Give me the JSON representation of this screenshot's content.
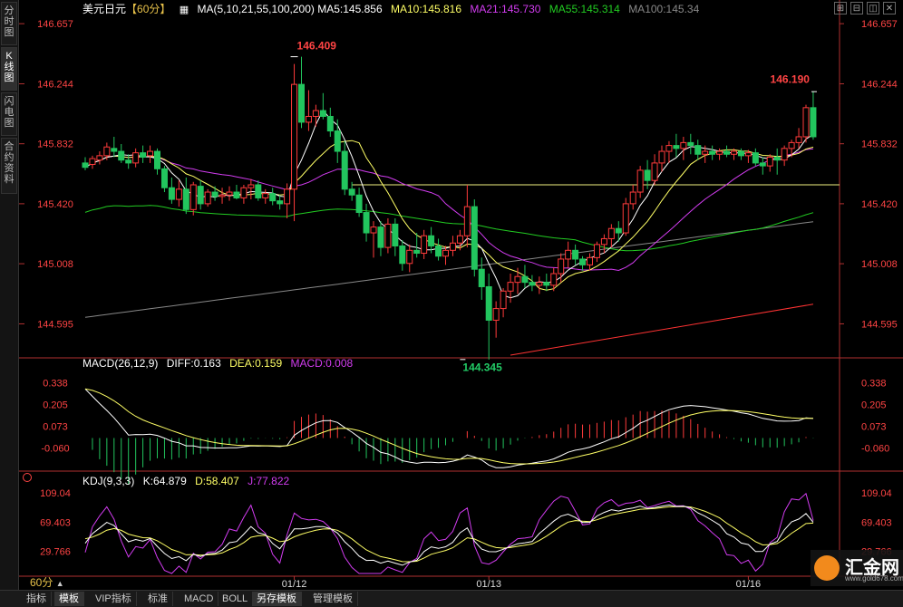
{
  "sidebar": {
    "tabs": [
      {
        "label": "分时图",
        "active": false
      },
      {
        "label": "K线图",
        "active": true
      },
      {
        "label": "闪电图",
        "active": false
      },
      {
        "label": "合约资料",
        "active": false
      }
    ]
  },
  "header": {
    "symbol": "美元日元",
    "period_tag": "【60分】",
    "ma_params": "MA(5,10,21,55,100,200)",
    "ma5": "MA5:145.856",
    "ma10": "MA10:145.816",
    "ma21": "MA21:145.730",
    "ma55": "MA55:145.314",
    "ma100": "MA100:145.34"
  },
  "macd_legend": {
    "params": "MACD(26,12,9)",
    "diff": "DIFF:0.163",
    "dea": "DEA:0.159",
    "macd": "MACD:0.008"
  },
  "kdj_legend": {
    "params": "KDJ(9,3,3)",
    "k": "K:64.879",
    "d": "D:58.407",
    "j": "J:77.822"
  },
  "bottom_bar": {
    "period": "60分",
    "items": [
      {
        "label": "指标",
        "active": false
      },
      {
        "label": "模板",
        "active": true
      },
      {
        "label": "VIP指标",
        "active": false
      },
      {
        "label": "标准",
        "active": false
      },
      {
        "label": "MACD",
        "active": false
      },
      {
        "label": "BOLL",
        "active": false
      },
      {
        "label": "另存模板",
        "active": true
      },
      {
        "label": "管理模板",
        "active": false
      }
    ]
  },
  "logo": {
    "name": "汇金网",
    "url": "www.gold678.com"
  },
  "colors": {
    "up": "#ff3b3b",
    "down": "#22c55e",
    "ma5": "#ffffff",
    "ma10": "#ffff66",
    "ma21": "#d23cf0",
    "ma55": "#22cc22",
    "ma100": "#888888",
    "ma200": "#ff3333",
    "hline": "#f0f080",
    "price_label": "#ff4444",
    "low_label": "#22cc66",
    "axis": "#ff4444"
  },
  "chart_data": {
    "type": "candlestick",
    "price_axis_ticks": [
      146.657,
      146.244,
      145.832,
      145.42,
      145.008,
      144.595
    ],
    "price_ylim": [
      144.38,
      146.72
    ],
    "x_labels": [
      {
        "index": 29,
        "label": "01/12"
      },
      {
        "index": 56,
        "label": "01/13"
      },
      {
        "index": 92,
        "label": "01/16"
      }
    ],
    "annotations": {
      "high": "146.409",
      "high_index": 29,
      "low": "144.345",
      "low_index": 52,
      "last_high": "146.190",
      "last_index": 101
    },
    "horizontal_line": 145.55,
    "candles": [
      [
        145.7,
        145.74,
        145.65,
        145.67
      ],
      [
        145.69,
        145.75,
        145.66,
        145.73
      ],
      [
        145.72,
        145.78,
        145.69,
        145.75
      ],
      [
        145.75,
        145.84,
        145.72,
        145.81
      ],
      [
        145.8,
        145.88,
        145.74,
        145.78
      ],
      [
        145.78,
        145.83,
        145.7,
        145.72
      ],
      [
        145.72,
        145.76,
        145.66,
        145.7
      ],
      [
        145.7,
        145.8,
        145.67,
        145.77
      ],
      [
        145.77,
        145.82,
        145.7,
        145.74
      ],
      [
        145.75,
        145.82,
        145.7,
        145.78
      ],
      [
        145.78,
        145.8,
        145.62,
        145.66
      ],
      [
        145.66,
        145.68,
        145.5,
        145.53
      ],
      [
        145.53,
        145.6,
        145.42,
        145.45
      ],
      [
        145.45,
        145.58,
        145.4,
        145.52
      ],
      [
        145.52,
        145.6,
        145.35,
        145.38
      ],
      [
        145.38,
        145.57,
        145.34,
        145.55
      ],
      [
        145.54,
        145.58,
        145.38,
        145.42
      ],
      [
        145.42,
        145.52,
        145.4,
        145.5
      ],
      [
        145.5,
        145.54,
        145.44,
        145.47
      ],
      [
        145.47,
        145.53,
        145.42,
        145.48
      ],
      [
        145.48,
        145.54,
        145.44,
        145.5
      ],
      [
        145.5,
        145.55,
        145.45,
        145.46
      ],
      [
        145.46,
        145.55,
        145.42,
        145.53
      ],
      [
        145.53,
        145.59,
        145.45,
        145.55
      ],
      [
        145.55,
        145.58,
        145.44,
        145.46
      ],
      [
        145.46,
        145.52,
        145.42,
        145.49
      ],
      [
        145.49,
        145.53,
        145.41,
        145.44
      ],
      [
        145.44,
        145.48,
        145.38,
        145.42
      ],
      [
        145.42,
        145.56,
        145.32,
        145.52
      ],
      [
        145.52,
        146.38,
        145.3,
        146.24
      ],
      [
        146.24,
        146.43,
        145.94,
        145.98
      ],
      [
        145.98,
        146.2,
        145.92,
        146.02
      ],
      [
        146.02,
        146.1,
        145.95,
        146.06
      ],
      [
        146.06,
        146.18,
        146.0,
        146.02
      ],
      [
        146.02,
        146.08,
        145.88,
        145.92
      ],
      [
        145.92,
        146.0,
        145.7,
        145.78
      ],
      [
        145.78,
        145.85,
        145.48,
        145.52
      ],
      [
        145.52,
        145.57,
        145.44,
        145.48
      ],
      [
        145.48,
        145.53,
        145.33,
        145.36
      ],
      [
        145.36,
        145.42,
        145.16,
        145.22
      ],
      [
        145.22,
        145.3,
        145.05,
        145.26
      ],
      [
        145.26,
        145.3,
        145.06,
        145.12
      ],
      [
        145.12,
        145.32,
        145.08,
        145.28
      ],
      [
        145.28,
        145.32,
        145.06,
        145.13
      ],
      [
        145.13,
        145.17,
        144.96,
        145.01
      ],
      [
        145.01,
        145.14,
        144.95,
        145.1
      ],
      [
        145.1,
        145.22,
        145.05,
        145.08
      ],
      [
        145.08,
        145.24,
        145.04,
        145.2
      ],
      [
        145.2,
        145.26,
        145.08,
        145.13
      ],
      [
        145.13,
        145.18,
        145.03,
        145.06
      ],
      [
        145.06,
        145.13,
        145.0,
        145.1
      ],
      [
        145.1,
        145.2,
        145.06,
        145.15
      ],
      [
        145.15,
        145.24,
        145.1,
        145.2
      ],
      [
        145.2,
        145.55,
        145.12,
        145.4
      ],
      [
        145.4,
        145.45,
        144.92,
        144.97
      ],
      [
        144.97,
        145.05,
        144.76,
        144.85
      ],
      [
        144.85,
        144.94,
        144.35,
        144.62
      ],
      [
        144.62,
        144.75,
        144.5,
        144.7
      ],
      [
        144.7,
        144.84,
        144.64,
        144.82
      ],
      [
        144.82,
        144.94,
        144.74,
        144.88
      ],
      [
        144.88,
        144.98,
        144.8,
        144.92
      ],
      [
        144.92,
        145.0,
        144.84,
        144.88
      ],
      [
        144.88,
        144.93,
        144.82,
        144.86
      ],
      [
        144.86,
        144.92,
        144.8,
        144.88
      ],
      [
        144.88,
        144.94,
        144.82,
        144.86
      ],
      [
        144.86,
        144.98,
        144.82,
        144.94
      ],
      [
        144.94,
        145.08,
        144.88,
        145.04
      ],
      [
        145.04,
        145.16,
        144.98,
        145.1
      ],
      [
        145.1,
        145.14,
        145.0,
        145.04
      ],
      [
        145.04,
        145.06,
        144.96,
        145.0
      ],
      [
        145.0,
        145.08,
        144.96,
        145.05
      ],
      [
        145.05,
        145.16,
        145.02,
        145.14
      ],
      [
        145.14,
        145.21,
        145.08,
        145.18
      ],
      [
        145.18,
        145.28,
        145.12,
        145.25
      ],
      [
        145.25,
        145.3,
        145.16,
        145.22
      ],
      [
        145.22,
        145.46,
        145.2,
        145.42
      ],
      [
        145.42,
        145.55,
        145.38,
        145.5
      ],
      [
        145.5,
        145.68,
        145.46,
        145.65
      ],
      [
        145.65,
        145.72,
        145.52,
        145.58
      ],
      [
        145.58,
        145.76,
        145.55,
        145.7
      ],
      [
        145.7,
        145.82,
        145.64,
        145.78
      ],
      [
        145.78,
        145.85,
        145.7,
        145.82
      ],
      [
        145.82,
        145.9,
        145.74,
        145.8
      ],
      [
        145.8,
        145.88,
        145.72,
        145.84
      ],
      [
        145.84,
        145.9,
        145.76,
        145.82
      ],
      [
        145.82,
        145.86,
        145.72,
        145.76
      ],
      [
        145.76,
        145.82,
        145.7,
        145.78
      ],
      [
        145.78,
        145.82,
        145.72,
        145.76
      ],
      [
        145.76,
        145.8,
        145.72,
        145.78
      ],
      [
        145.78,
        145.82,
        145.74,
        145.76
      ],
      [
        145.76,
        145.8,
        145.72,
        145.78
      ],
      [
        145.78,
        145.8,
        145.72,
        145.75
      ],
      [
        145.75,
        145.79,
        145.7,
        145.77
      ],
      [
        145.77,
        145.8,
        145.68,
        145.7
      ],
      [
        145.7,
        145.74,
        145.62,
        145.68
      ],
      [
        145.68,
        145.76,
        145.64,
        145.74
      ],
      [
        145.74,
        145.8,
        145.62,
        145.72
      ],
      [
        145.72,
        145.82,
        145.68,
        145.8
      ],
      [
        145.8,
        145.86,
        145.74,
        145.84
      ],
      [
        145.84,
        145.94,
        145.8,
        145.88
      ],
      [
        145.88,
        146.1,
        145.84,
        146.08
      ],
      [
        146.08,
        146.19,
        145.86,
        145.88
      ]
    ],
    "ma200": {
      "start_index": 59,
      "start": 144.38,
      "end": 144.73
    },
    "macd": {
      "title": "MACD(26,12,9)",
      "ticks": [
        0.338,
        0.205,
        0.073,
        -0.06
      ],
      "ylim": [
        -0.18,
        0.44
      ]
    },
    "kdj": {
      "title": "KDJ(9,3,3)",
      "ticks": [
        109.04,
        69.403,
        29.766
      ],
      "ylim": [
        0,
        120
      ]
    }
  }
}
